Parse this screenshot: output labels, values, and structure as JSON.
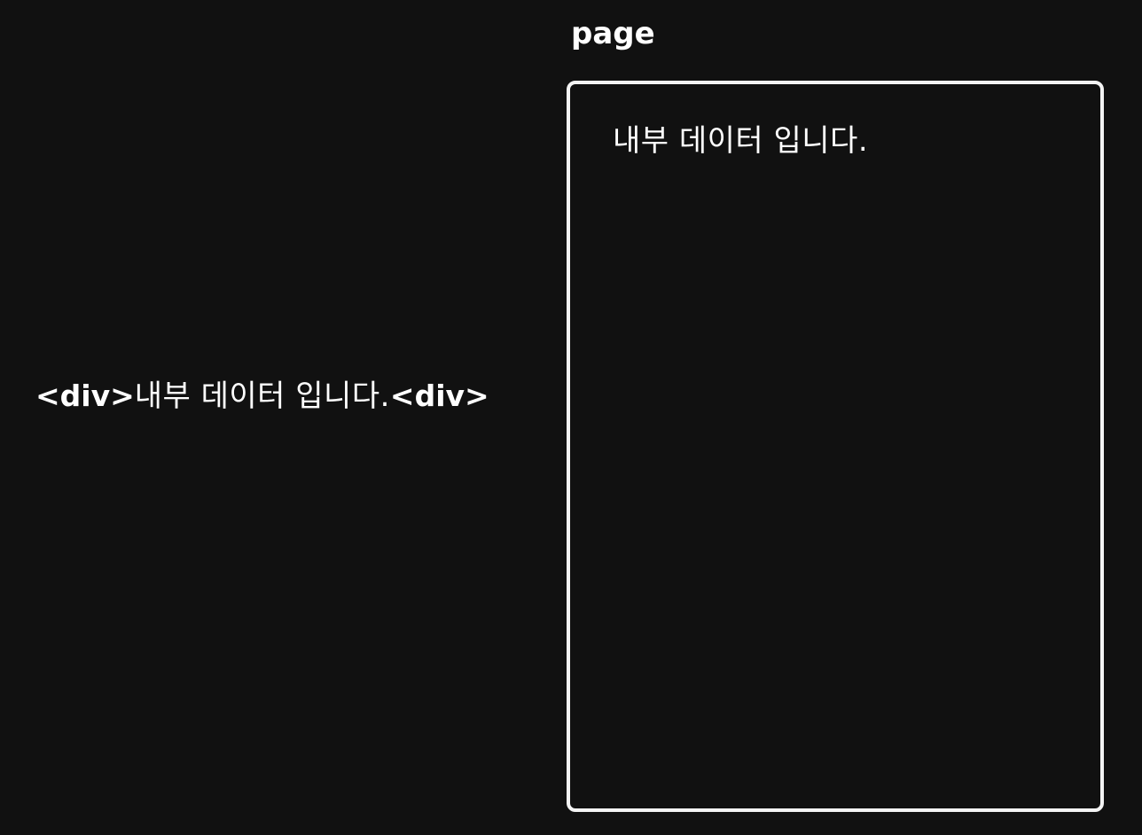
{
  "code": {
    "open_tag": "<div>",
    "content": "내부 데이터 입니다.",
    "close_tag": "<div>"
  },
  "page": {
    "title": "page",
    "content": "내부 데이터 입니다."
  },
  "colors": {
    "background": "#111111",
    "foreground": "#ffffff",
    "frame_border": "#f4f4f4"
  }
}
